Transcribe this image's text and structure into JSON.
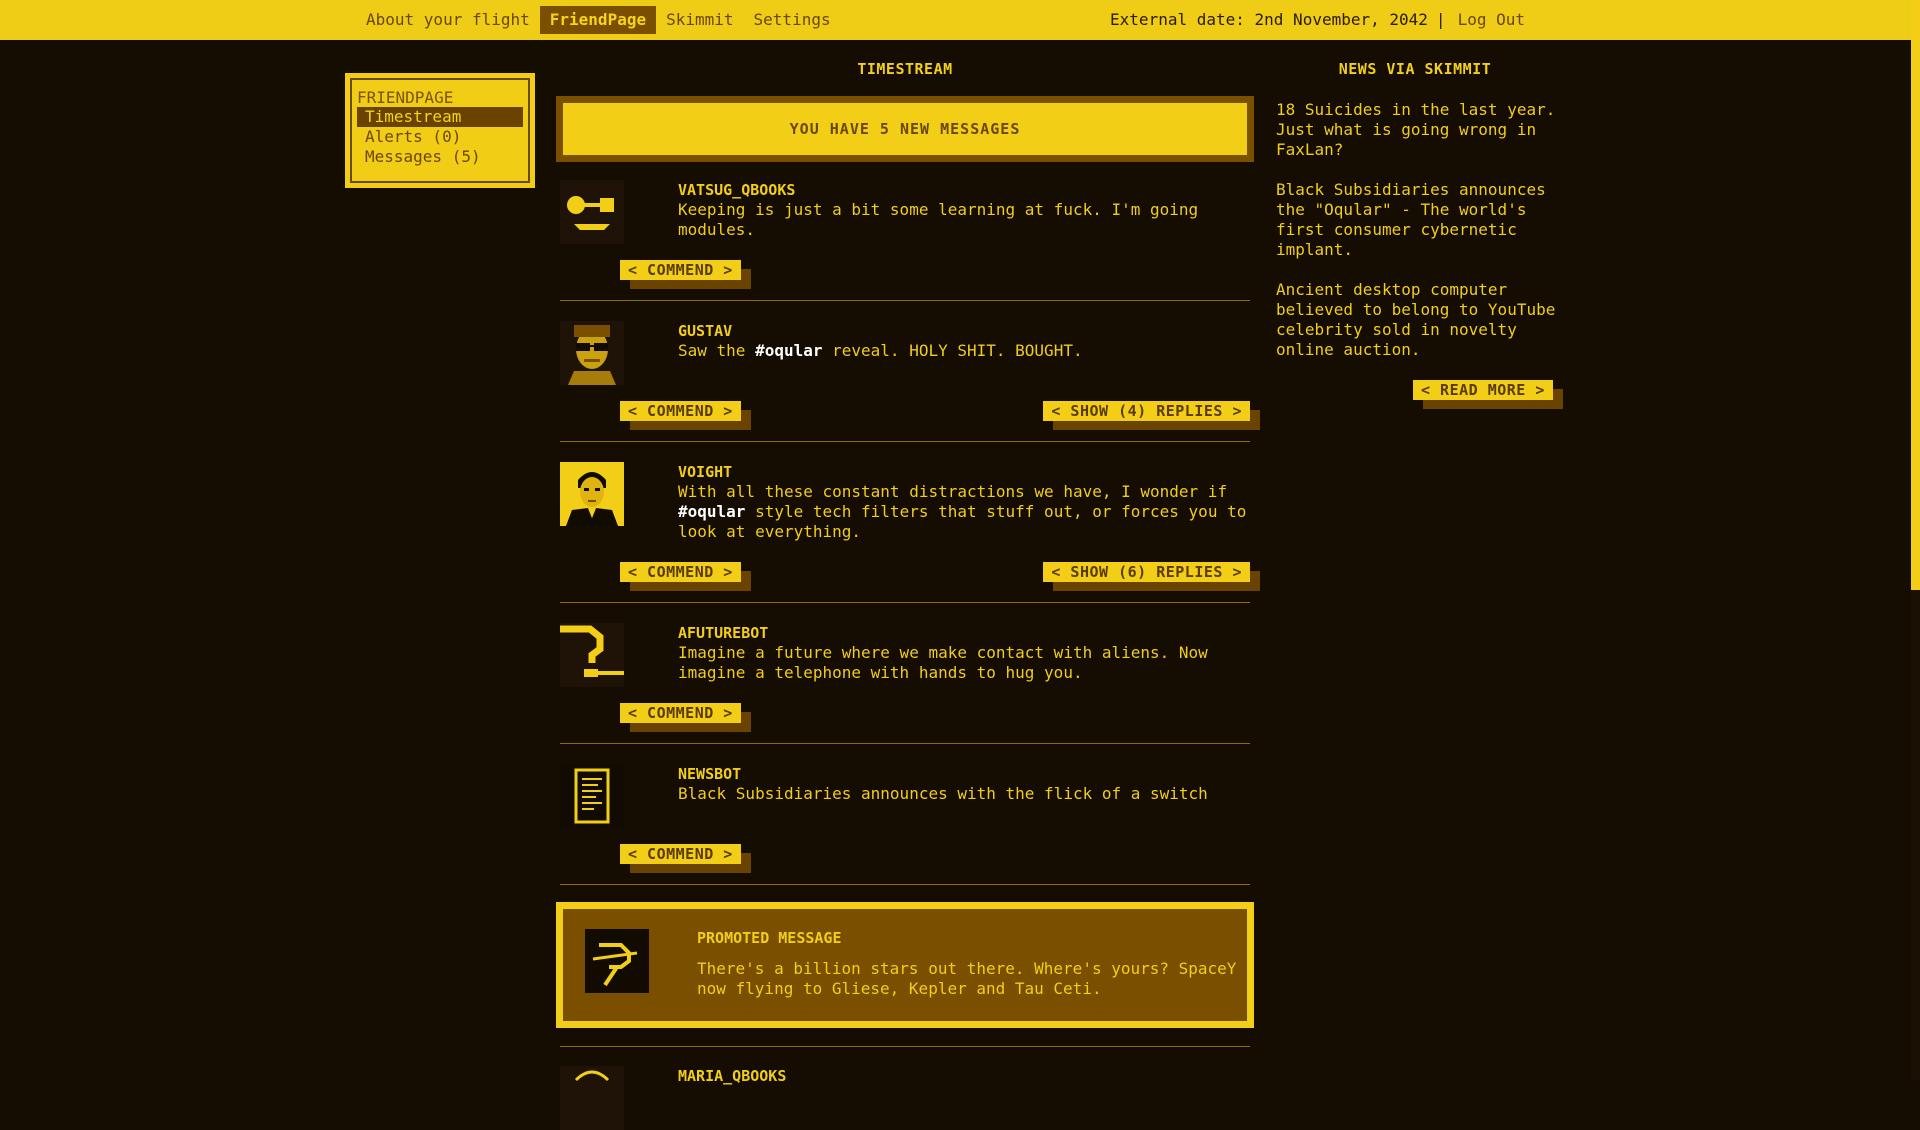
{
  "topbar": {
    "nav": [
      "About your flight",
      "FriendPage",
      "Skimmit",
      "Settings"
    ],
    "active_nav": "FriendPage",
    "external_date": "External date: 2nd November, 2042",
    "separator": "|",
    "logout": "Log Out"
  },
  "leftmenu": {
    "title": "FRIENDPAGE",
    "items": [
      "Timestream",
      "Alerts (0)",
      "Messages (5)"
    ],
    "active": "Timestream"
  },
  "timestream": {
    "title": "TIMESTREAM",
    "new_messages": "YOU HAVE 5 NEW MESSAGES",
    "comment_label": "< COMMEND >",
    "posts": [
      {
        "author": "VATSUG_QBOOKS",
        "text": "Keeping is just a bit some learning at fuck. I'm going modules.",
        "avatar": "key-icon"
      },
      {
        "author": "GUSTAV",
        "text_before": "Saw the ",
        "tag": "#oqular",
        "text_after": " reveal. HOLY SHIT. BOUGHT.",
        "replies_label": "< SHOW (4) REPLIES >",
        "avatar": "sunglasses-face-icon"
      },
      {
        "author": "VOIGHT",
        "text_before": "With all these constant distractions we have, I wonder if ",
        "tag": "#oqular",
        "text_after": " style tech filters that stuff out, or forces you to look at everything.",
        "replies_label": "< SHOW (6) REPLIES >",
        "avatar": "man-portrait-icon"
      },
      {
        "author": "AFUTUREBOT",
        "text": "Imagine a future where we make contact with aliens. Now imagine a telephone with hands to hug you.",
        "avatar": "question-mark-icon"
      },
      {
        "author": "NEWSBOT",
        "text": "Black Subsidiaries announces with the flick of a switch",
        "avatar": "document-icon"
      }
    ],
    "promoted": {
      "title": "PROMOTED MESSAGE",
      "text": "There's a billion stars out there. Where's yours? SpaceY now flying to Gliese, Kepler and Tau Ceti.",
      "avatar": "spacey-logo-icon"
    },
    "partial_post_author": "MARIA_QBOOKS"
  },
  "news": {
    "title": "NEWS VIA SKIMMIT",
    "items": [
      "18 Suicides in the last year. Just what is going wrong in FaxLan?",
      "Black Subsidiaries announces the \"Oqular\" - The world's first consumer cybernetic implant.",
      "Ancient desktop computer believed to belong to YouTube celebrity sold in novelty online auction."
    ],
    "read_more": "< READ MORE >"
  },
  "colors": {
    "background": "#150c02",
    "accent_yellow": "#f2ce16",
    "dark_brown": "#7a5000"
  }
}
